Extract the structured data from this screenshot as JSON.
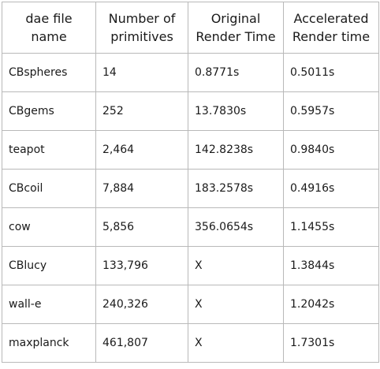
{
  "table": {
    "headers": [
      [
        "dae file",
        "name"
      ],
      [
        "Number of",
        "primitives"
      ],
      [
        "Original",
        "Render Time"
      ],
      [
        "Accelerated",
        "Render time"
      ]
    ],
    "rows": [
      [
        "CBspheres",
        "14",
        "0.8771s",
        "0.5011s"
      ],
      [
        "CBgems",
        "252",
        "13.7830s",
        "0.5957s"
      ],
      [
        "teapot",
        "2,464",
        "142.8238s",
        "0.9840s"
      ],
      [
        "CBcoil",
        "7,884",
        "183.2578s",
        "0.4916s"
      ],
      [
        "cow",
        "5,856",
        "356.0654s",
        "1.1455s"
      ],
      [
        "CBlucy",
        "133,796",
        "X",
        "1.3844s"
      ],
      [
        "wall-e",
        "240,326",
        "X",
        "1.2042s"
      ],
      [
        "maxplanck",
        "461,807",
        "X",
        "1.7301s"
      ]
    ]
  },
  "colors": {
    "border": "#b9b9b9",
    "text": "#1a1a1a",
    "background": "#ffffff"
  }
}
